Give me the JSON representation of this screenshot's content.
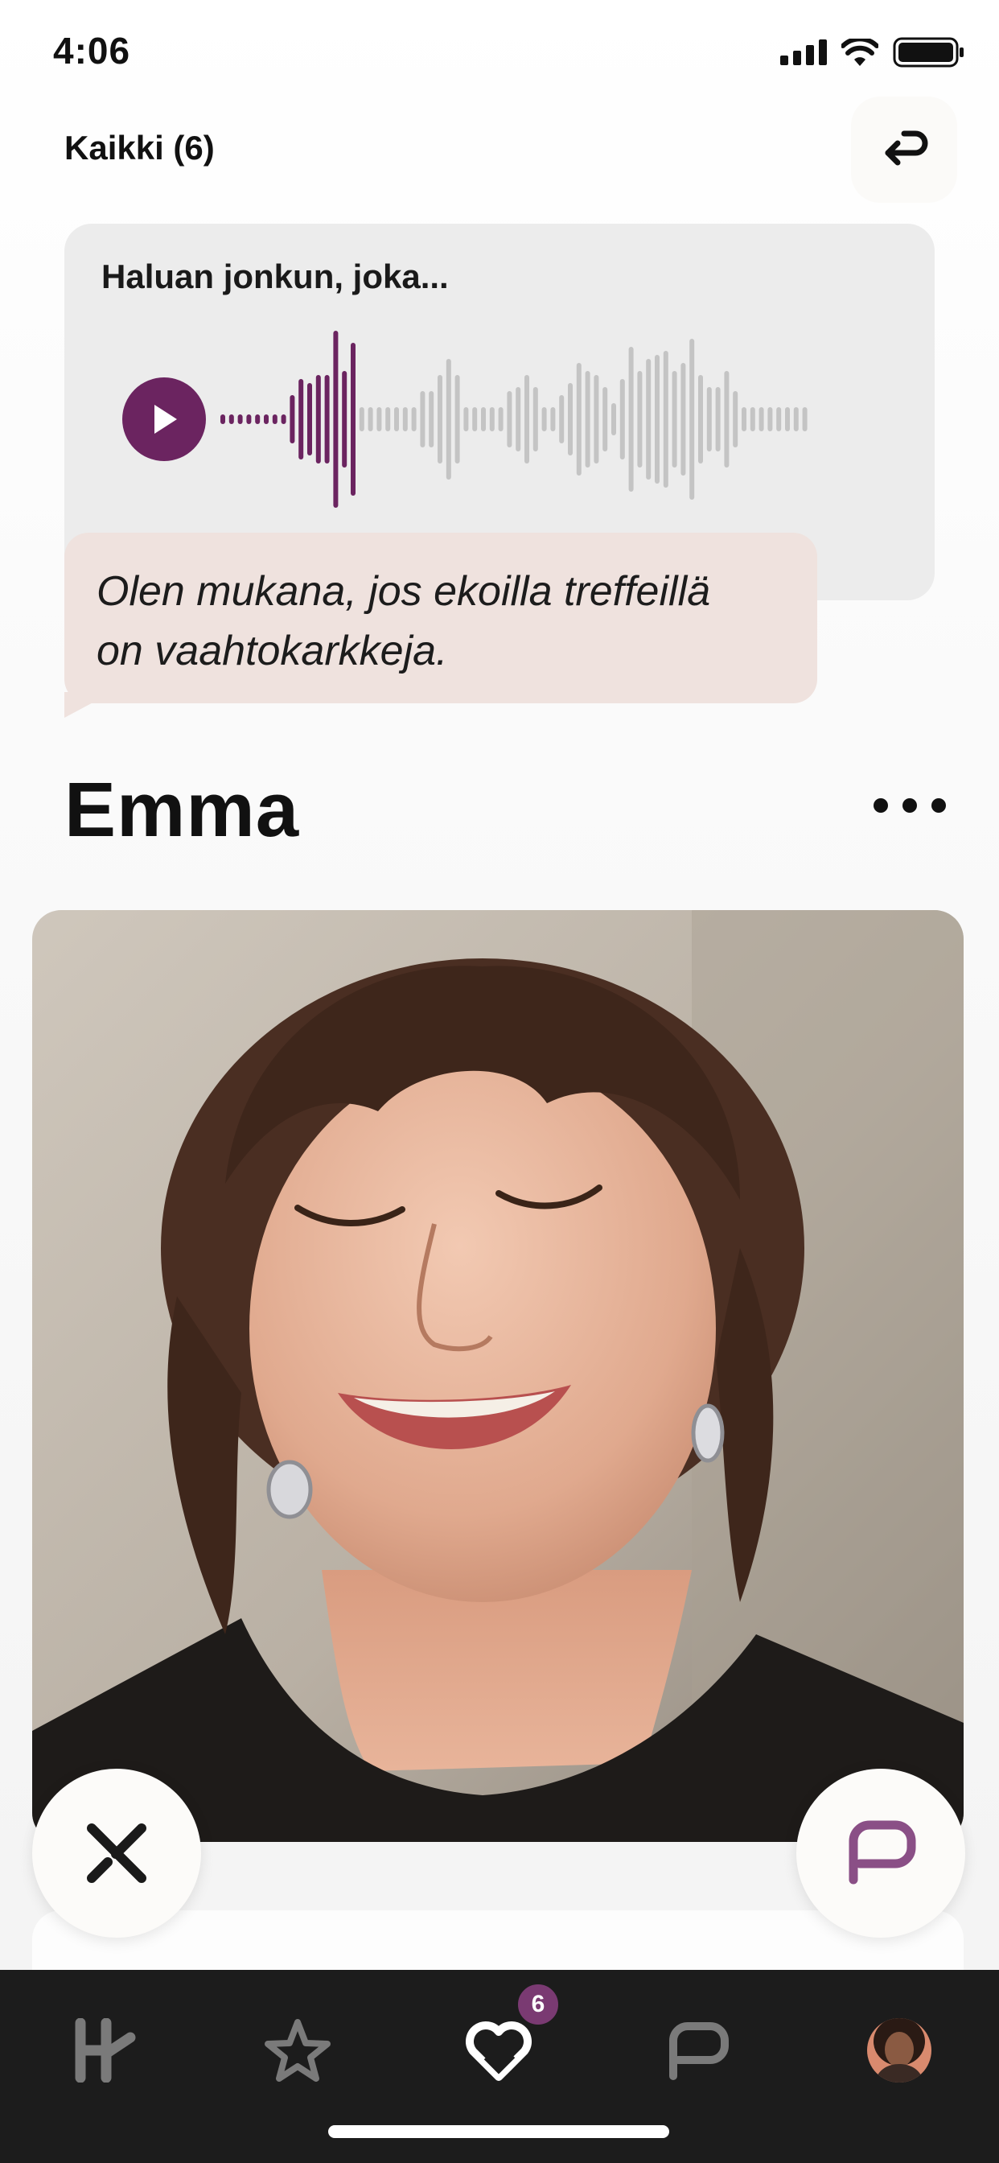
{
  "status_bar": {
    "time": "4:06"
  },
  "header": {
    "filter_label": "Kaikki (6)"
  },
  "prompt": {
    "title": "Haluan jonkun, joka...",
    "audio_progress": 0.23
  },
  "reply": {
    "text": "Olen mukana, jos ekoilla treffeillä\non vaahtokarkkeja."
  },
  "profile": {
    "name": "Emma"
  },
  "tabs": [
    {
      "icon": "hinge-logo-icon"
    },
    {
      "icon": "star-icon"
    },
    {
      "icon": "likes-heart-icon",
      "active": true
    },
    {
      "icon": "chat-icon"
    },
    {
      "icon": "profile-avatar"
    }
  ],
  "likes_badge": "6",
  "colors": {
    "accent": "#6b2460",
    "prompt_bg": "#ececec",
    "reply_bg": "#efe2de",
    "tab_bar": "#1c1c1c"
  }
}
